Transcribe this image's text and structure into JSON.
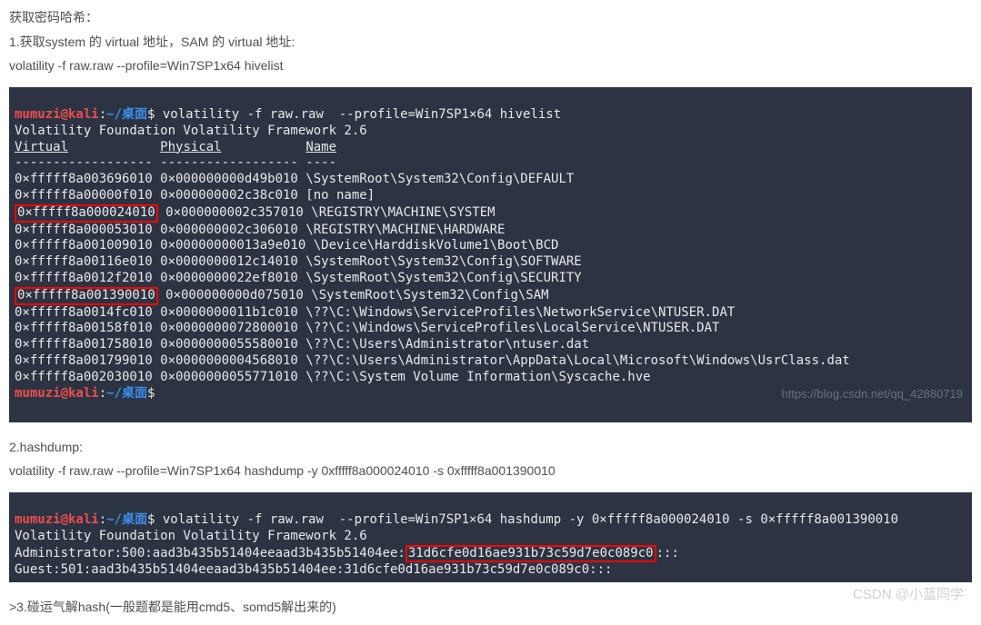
{
  "intro": {
    "title": "获取密码哈希：",
    "step1": "1.获取system 的 virtual 地址，SAM 的 virtual 地址:",
    "cmd1": "volatility -f raw.raw --profile=Win7SP1x64 hivelist"
  },
  "term1": {
    "prompt_user": "mumuzi@kali",
    "prompt_sep": ":",
    "prompt_path": "~/桌面",
    "prompt_dollar": "$ ",
    "cmd": "volatility -f raw.raw  --profile=Win7SP1×64 hivelist",
    "banner": "Volatility Foundation Volatility Framework 2.6",
    "col_virtual": "Virtual",
    "col_physical": "Physical",
    "col_name": "Name",
    "row0": "0×fffff8a003696010 0×000000000d49b010 \\SystemRoot\\System32\\Config\\DEFAULT",
    "row1": "0×fffff8a00000f010 0×000000002c38c010 [no name]",
    "row2a": "0×fffff8a000024010",
    "row2b": " 0×000000002c357010 \\REGISTRY\\MACHINE\\SYSTEM",
    "row3": "0×fffff8a000053010 0×000000002c306010 \\REGISTRY\\MACHINE\\HARDWARE",
    "row4": "0×fffff8a001009010 0×00000000013a9e010 \\Device\\HarddiskVolume1\\Boot\\BCD",
    "row5": "0×fffff8a00116e010 0×0000000012c14010 \\SystemRoot\\System32\\Config\\SOFTWARE",
    "row6": "0×fffff8a0012f2010 0×0000000022ef8010 \\SystemRoot\\System32\\Config\\SECURITY",
    "row7a": "0×fffff8a001390010",
    "row7b": " 0×000000000d075010 \\SystemRoot\\System32\\Config\\SAM",
    "row8": "0×fffff8a0014fc010 0×0000000011b1c010 \\??\\C:\\Windows\\ServiceProfiles\\NetworkService\\NTUSER.DAT",
    "row9": "0×fffff8a00158f010 0×0000000072800010 \\??\\C:\\Windows\\ServiceProfiles\\LocalService\\NTUSER.DAT",
    "row10": "0×fffff8a001758010 0×0000000055580010 \\??\\C:\\Users\\Administrator\\ntuser.dat",
    "row11": "0×fffff8a001799010 0×0000000004568010 \\??\\C:\\Users\\Administrator\\AppData\\Local\\Microsoft\\Windows\\UsrClass.dat",
    "row12": "0×fffff8a002030010 0×0000000055771010 \\??\\C:\\System Volume Information\\Syscache.hve",
    "wm": "https://blog.csdn.net/qq_42880719"
  },
  "intro2": {
    "step2": "2.hashdump:",
    "cmd2": "volatility -f raw.raw --profile=Win7SP1x64 hashdump -y 0xfffff8a000024010 -s 0xfffff8a001390010"
  },
  "term2": {
    "prompt_user": "mumuzi@kali",
    "prompt_sep": ":",
    "prompt_path": "~/桌面",
    "prompt_dollar": "$ ",
    "cmd": "volatility -f raw.raw  --profile=Win7SP1×64 hashdump -y 0×fffff8a000024010 -s 0×fffff8a001390010",
    "banner": "Volatility Foundation Volatility Framework 2.6",
    "lineA_pre": "Administrator:500:aad3b435b51404eeaad3b435b51404ee:",
    "lineA_box": "31d6cfe0d16ae931b73c59d7e0c089c0",
    "lineA_post": ":::",
    "lineB": "Guest:501:aad3b435b51404eeaad3b435b51404ee:31d6cfe0d16ae931b73c59d7e0c089c0:::"
  },
  "intro3": {
    "step3": ">3.碰运气解hash(一般题都是能用cmd5、somd5解出来的)"
  },
  "watermark2": "CSDN @小蓝同学`"
}
